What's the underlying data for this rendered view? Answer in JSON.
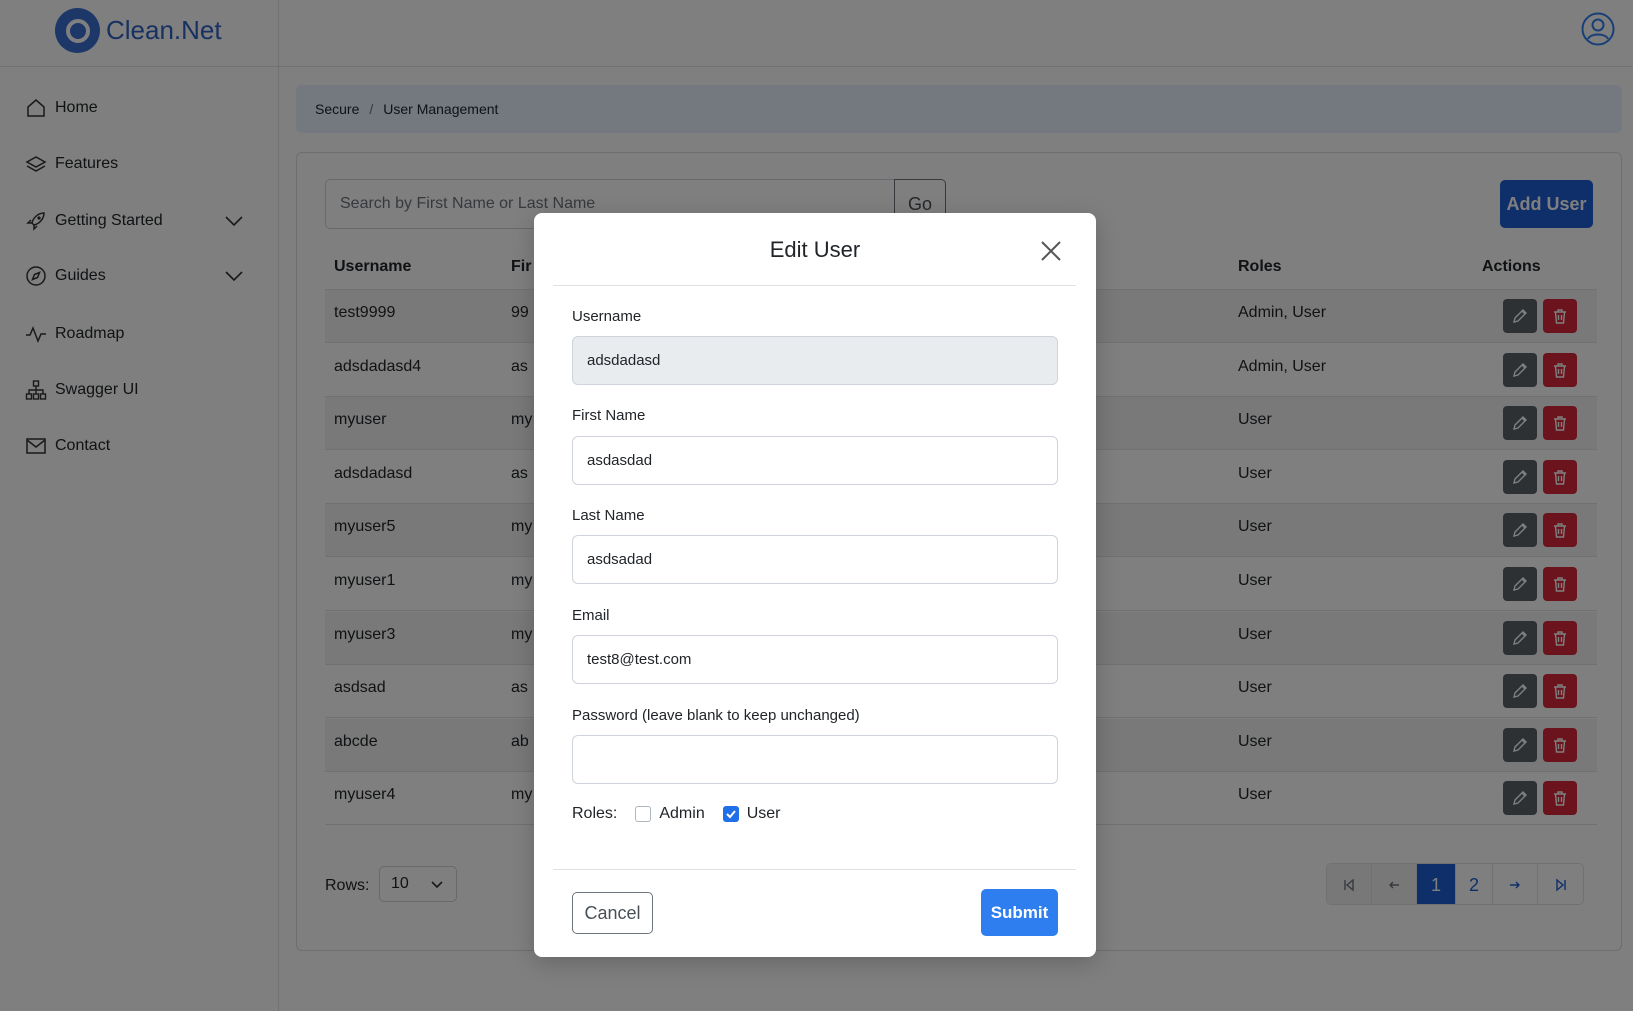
{
  "app": {
    "brand_name": "Clean.Net",
    "brand_color": "#2f63c4"
  },
  "sidebar": {
    "items": [
      {
        "label": "Home",
        "icon": "home-icon"
      },
      {
        "label": "Features",
        "icon": "layers-icon"
      },
      {
        "label": "Getting Started",
        "icon": "rocket-icon",
        "expandable": true
      },
      {
        "label": "Guides",
        "icon": "compass-icon",
        "expandable": true
      },
      {
        "label": "Roadmap",
        "icon": "activity-icon"
      },
      {
        "label": "Swagger UI",
        "icon": "sitemap-icon"
      },
      {
        "label": "Contact",
        "icon": "envelope-icon"
      }
    ]
  },
  "breadcrumb": {
    "items": [
      "Secure",
      "User Management"
    ],
    "separator": "/"
  },
  "toolbar": {
    "search_placeholder": "Search by First Name or Last Name",
    "go_label": "Go",
    "add_user_label": "Add User"
  },
  "table": {
    "headers": {
      "username": "Username",
      "first_name_partial": "Fir",
      "roles": "Roles",
      "actions": "Actions"
    },
    "rows": [
      {
        "username": "test9999",
        "first": "99",
        "roles": "Admin, User"
      },
      {
        "username": "adsdadasd4",
        "first": "as",
        "roles": "Admin, User"
      },
      {
        "username": "myuser",
        "first": "my",
        "roles": "User"
      },
      {
        "username": "adsdadasd",
        "first": "as",
        "roles": "User"
      },
      {
        "username": "myuser5",
        "first": "my",
        "roles": "User"
      },
      {
        "username": "myuser1",
        "first": "my",
        "roles": "User"
      },
      {
        "username": "myuser3",
        "first": "my",
        "roles": "User"
      },
      {
        "username": "asdsad",
        "first": "as",
        "roles": "User"
      },
      {
        "username": "abcde",
        "first": "ab",
        "roles": "User"
      },
      {
        "username": "myuser4",
        "first": "my",
        "roles": "User"
      }
    ]
  },
  "pagination": {
    "rows_label": "Rows:",
    "rows_value": "10",
    "pages": [
      "1",
      "2"
    ],
    "current_page": "1"
  },
  "modal": {
    "title": "Edit User",
    "fields": {
      "username_label": "Username",
      "username_value": "adsdadasd",
      "first_name_label": "First Name",
      "first_name_value": "asdasdad",
      "last_name_label": "Last Name",
      "last_name_value": "asdsadad",
      "email_label": "Email",
      "email_value": "test8@test.com",
      "password_label": "Password (leave blank to keep unchanged)",
      "password_value": ""
    },
    "roles_label": "Roles:",
    "roles": [
      {
        "label": "Admin",
        "checked": false
      },
      {
        "label": "User",
        "checked": true
      }
    ],
    "cancel_label": "Cancel",
    "submit_label": "Submit"
  },
  "colors": {
    "primary": "#1f5fd6",
    "danger": "#d6293a",
    "secondary": "#5c6268",
    "breadcrumb_bg": "#e8f0ff"
  }
}
